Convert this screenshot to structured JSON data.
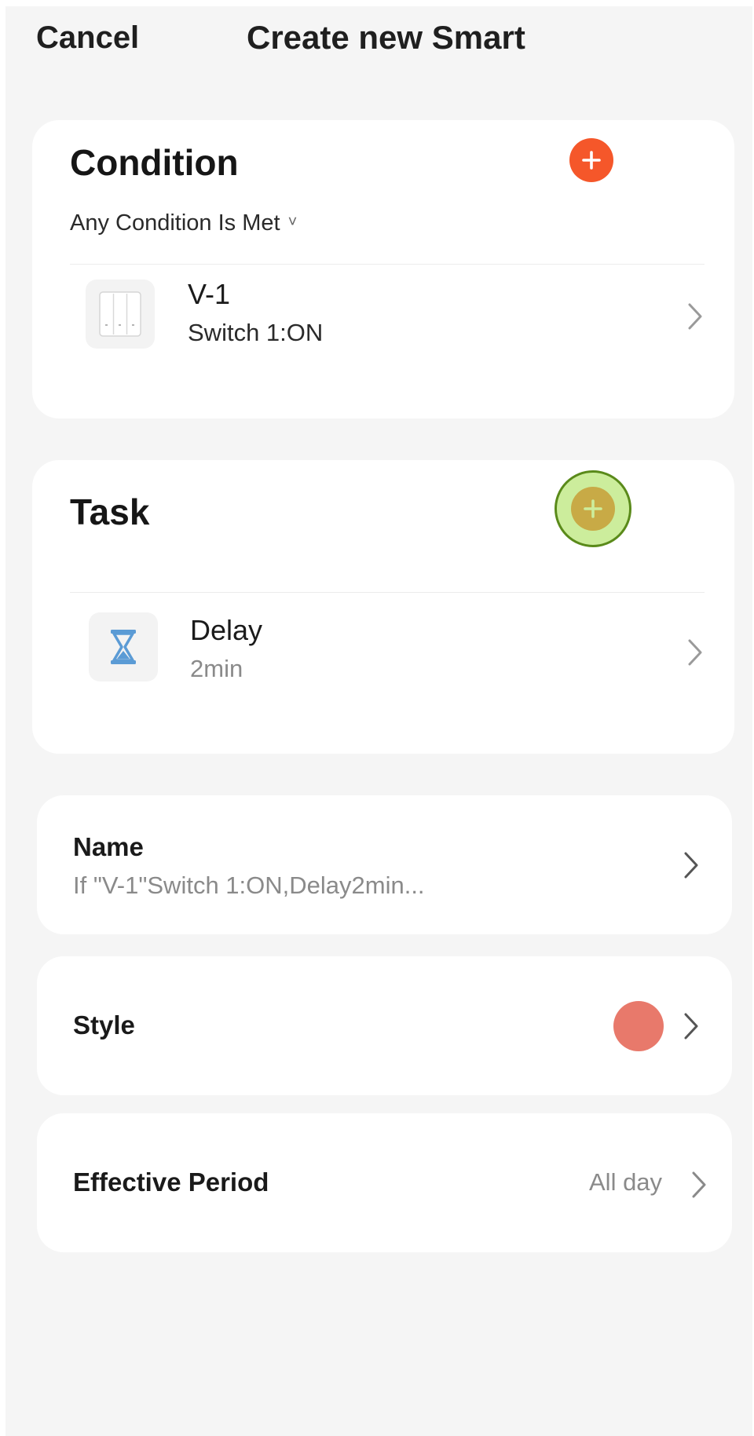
{
  "header": {
    "cancel_label": "Cancel",
    "title": "Create new Smart"
  },
  "condition": {
    "title": "Condition",
    "match_mode": "Any Condition Is Met",
    "items": [
      {
        "device": "V-1",
        "detail": "Switch 1:ON",
        "icon": "wall-switch-icon"
      }
    ]
  },
  "task": {
    "title": "Task",
    "items": [
      {
        "name": "Delay",
        "detail": "2min",
        "icon": "hourglass-icon"
      }
    ]
  },
  "name_row": {
    "label": "Name",
    "value": "If \"V-1\"Switch 1:ON,Delay2min..."
  },
  "style_row": {
    "label": "Style",
    "color": "#e8796b"
  },
  "period_row": {
    "label": "Effective Period",
    "value": "All day"
  },
  "colors": {
    "accent": "#f5572a",
    "background": "#f5f5f5",
    "card": "#ffffff",
    "hourglass": "#5b9bd5",
    "highlight": "#aee15a"
  }
}
